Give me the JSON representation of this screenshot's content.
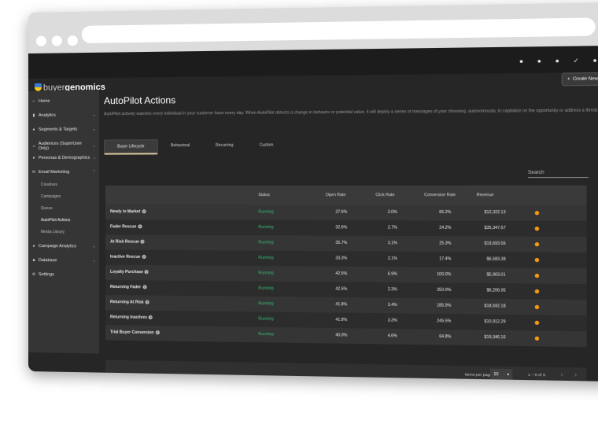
{
  "brand": {
    "part1": "buyer",
    "part2": "genomics"
  },
  "topbar_icons": [
    "lightbulb-icon",
    "bell-icon",
    "help-icon",
    "check-icon",
    "user-icon"
  ],
  "sidebar": {
    "items": [
      {
        "label": "Home",
        "icon": "home-icon"
      },
      {
        "label": "Analytics",
        "icon": "analytics-icon"
      },
      {
        "label": "Segments & Targets",
        "icon": "segments-icon"
      },
      {
        "label": "Audiences (SuperUser Only)",
        "icon": "audiences-icon"
      },
      {
        "label": "Personas & Demographics",
        "icon": "personas-icon"
      },
      {
        "label": "Email Marketing",
        "icon": "email-icon"
      }
    ],
    "email_sub": [
      "Creatives",
      "Campaigns",
      "Queue",
      "AutoPilot Actions",
      "Media Library"
    ],
    "bottom": [
      {
        "label": "Campaign Analytics",
        "icon": "campaign-analytics-icon"
      },
      {
        "label": "Database",
        "icon": "database-icon"
      },
      {
        "label": "Settings",
        "icon": "settings-icon"
      }
    ]
  },
  "page": {
    "title": "AutoPilot Actions",
    "description": "AutoPilot actively watches every individual in your customer base every day. When AutoPilot detects a change in behavior or potential value, it will deploy a series of messages of your choosing, autonomously, to capitalize on the opportunity or address a threat.",
    "create_label": "Create New",
    "search_placeholder": "Search"
  },
  "tabs": [
    "Buyer Lifecycle",
    "Behavioral",
    "Recurring",
    "Custom"
  ],
  "table": {
    "headers": [
      "Status",
      "Open Rate",
      "Click Rate",
      "Conversion Rate",
      "Revenue"
    ],
    "rows": [
      {
        "name": "Newly in Market",
        "status": "Running",
        "open": "37.6%",
        "click": "2.0%",
        "conv": "66.2%",
        "rev": "$12,322.13"
      },
      {
        "name": "Fader Rescue",
        "status": "Running",
        "open": "32.6%",
        "click": "2.7%",
        "conv": "24.2%",
        "rev": "$35,347.67"
      },
      {
        "name": "At Risk Rescue",
        "status": "Running",
        "open": "35.7%",
        "click": "3.1%",
        "conv": "25.3%",
        "rev": "$19,693.56"
      },
      {
        "name": "Inactive Rescue",
        "status": "Running",
        "open": "33.3%",
        "click": "2.1%",
        "conv": "17.4%",
        "rev": "$6,583.38"
      },
      {
        "name": "Loyalty Purchase",
        "status": "Running",
        "open": "42.5%",
        "click": "6.9%",
        "conv": "100.0%",
        "rev": "$5,903.01"
      },
      {
        "name": "Returning Fader",
        "status": "Running",
        "open": "42.5%",
        "click": "2.3%",
        "conv": "350.0%",
        "rev": "$6,206.95"
      },
      {
        "name": "Returning At Risk",
        "status": "Running",
        "open": "41.8%",
        "click": "3.4%",
        "conv": "185.9%",
        "rev": "$18,592.18"
      },
      {
        "name": "Returning Inactives",
        "status": "Running",
        "open": "41.8%",
        "click": "3.3%",
        "conv": "245.5%",
        "rev": "$10,912.29"
      },
      {
        "name": "Trial Buyer Conversion",
        "status": "Running",
        "open": "40.0%",
        "click": "4.6%",
        "conv": "64.8%",
        "rev": "$19,346.16"
      }
    ]
  },
  "pager": {
    "items_label": "Items per page:",
    "per_page": "10",
    "range": "1 – 9 of 9"
  }
}
